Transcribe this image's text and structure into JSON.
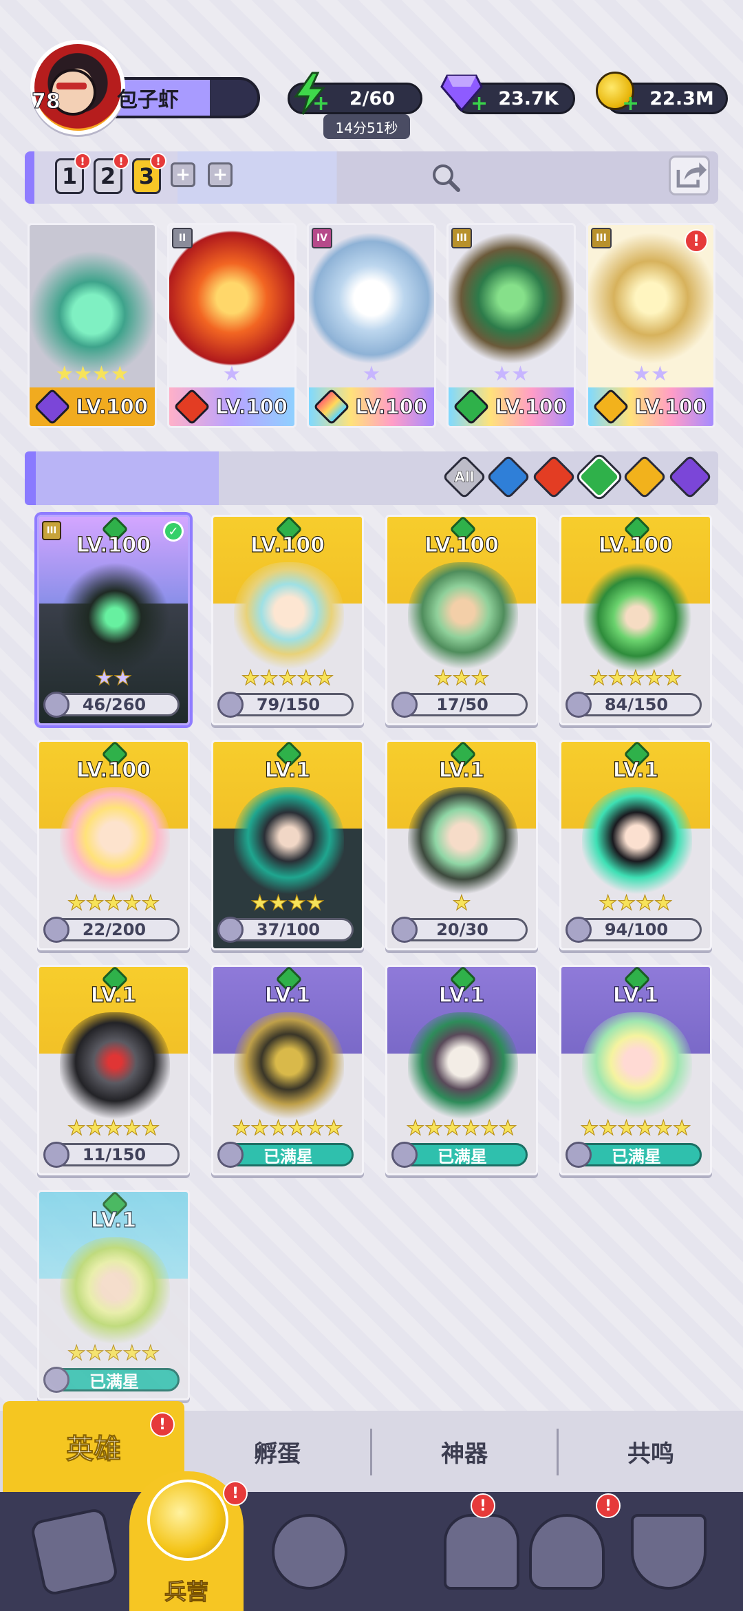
{
  "player": {
    "level": "78",
    "name": "包子虾"
  },
  "resources": {
    "energy": "2/60",
    "energy_timer": "14分51秒",
    "gems": "23.7K",
    "coins": "22.3M"
  },
  "team_tabs": [
    "1",
    "2",
    "3"
  ],
  "team_cards": [
    {
      "level": "LV.100",
      "rank": "",
      "element": "dark"
    },
    {
      "level": "LV.100",
      "rank": "II",
      "element": "fire"
    },
    {
      "level": "LV.100",
      "rank": "IV",
      "element": "all"
    },
    {
      "level": "LV.100",
      "rank": "III",
      "element": "nature"
    },
    {
      "level": "LV.100",
      "rank": "III",
      "element": "light"
    }
  ],
  "filters": [
    "All",
    "water",
    "fire",
    "nature",
    "light",
    "dark"
  ],
  "heroes": [
    {
      "level": "LV.100",
      "progress": "46/260",
      "rank": "III",
      "selected": true,
      "stars": 2
    },
    {
      "level": "LV.100",
      "progress": "79/150",
      "stars": 5
    },
    {
      "level": "LV.100",
      "progress": "17/50",
      "stars": 3
    },
    {
      "level": "LV.100",
      "progress": "84/150",
      "stars": 5
    },
    {
      "level": "LV.100",
      "progress": "22/200",
      "stars": 5
    },
    {
      "level": "LV.1",
      "progress": "37/100",
      "stars": 4
    },
    {
      "level": "LV.1",
      "progress": "20/30",
      "stars": 1
    },
    {
      "level": "LV.1",
      "progress": "94/100",
      "stars": 4
    },
    {
      "level": "LV.1",
      "progress": "11/150",
      "stars": 5
    },
    {
      "level": "LV.1",
      "progress": "已满星",
      "stars": 6
    },
    {
      "level": "LV.1",
      "progress": "已满星",
      "stars": 6
    },
    {
      "level": "LV.1",
      "progress": "已满星",
      "stars": 6
    },
    {
      "level": "LV.1",
      "progress": "已满星",
      "stars": 5
    }
  ],
  "sub_tabs": [
    "英雄",
    "孵蛋",
    "神器",
    "共鸣"
  ],
  "nav": {
    "active_label": "兵营"
  },
  "colors": {
    "gold": "#f5c621",
    "purple": "#8f7cff",
    "nature": "#2fb14a",
    "full_star_bar": "#2fc0ad"
  }
}
